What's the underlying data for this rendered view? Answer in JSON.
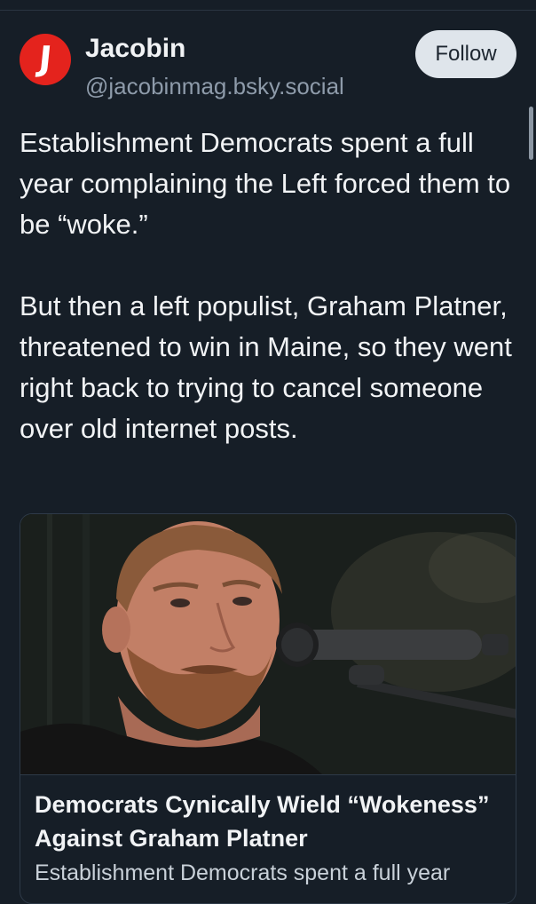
{
  "author": {
    "display_name": "Jacobin",
    "handle": "@jacobinmag.bsky.social",
    "avatar_letter": "J",
    "avatar_color": "#e4231d"
  },
  "follow_button": {
    "label": "Follow"
  },
  "post": {
    "text": "Establishment Democrats spent a full year complaining the Left forced them to be “woke.”\n\nBut then a left populist, Graham Platner, threatened to win in Maine, so they went right back to trying to cancel someone over old internet posts."
  },
  "link_card": {
    "image_icon": "man-at-microphone-photo",
    "title": "Democrats Cynically Wield “Wokeness” Against Graham Platner",
    "description": "Establishment Democrats spent a full year"
  },
  "colors": {
    "background": "#161e27",
    "text": "#f1f3f5",
    "muted": "#8e9baa",
    "button_bg": "#dfe5eb"
  }
}
